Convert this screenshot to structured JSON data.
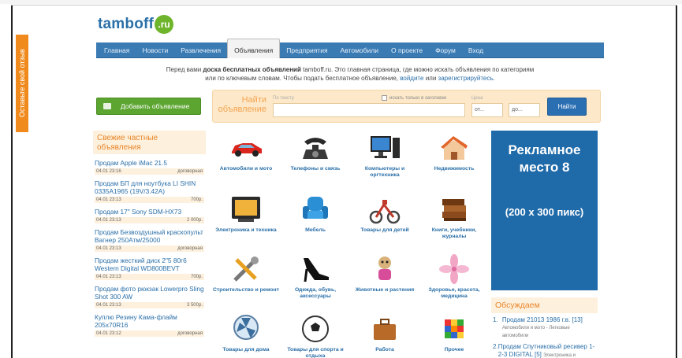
{
  "feedback_tab": "Оставьте свой отзыв",
  "logo": {
    "text": "tamboff",
    "badge": ".ru"
  },
  "nav": [
    "Главная",
    "Новости",
    "Развлечения",
    "Объявления",
    "Предприятия",
    "Автомобили",
    "О проекте",
    "Форум",
    "Вход"
  ],
  "intro": {
    "line1_prefix": "Перед вами ",
    "line1_bold": "доска бесплатных объявлений",
    "line1_suffix": " tamboff.ru. Это главная страница, где можно искать объявления по категориям",
    "line2_prefix": "или по ключевым словам. Чтобы подать бесплатное объявление, ",
    "link_login": "войдите",
    "line2_or": " или ",
    "link_register": "зарегистрируйтесь",
    "line2_end": "."
  },
  "add_button": "Добавить объявление",
  "search": {
    "title": "Найти объявление",
    "hint": "По тексту",
    "title_only": "искать только в заголовке",
    "price_label": "Цена",
    "price_from": "от...",
    "price_to": "до...",
    "find_button": "Найти"
  },
  "fresh": {
    "title": "Свежие частные объявления",
    "items": [
      {
        "title": "Продам Apple iMac 21.5",
        "date": "04.01 23:16",
        "price": "договорная"
      },
      {
        "title": "Продам БП для ноутбука LI SHIN 0335A1965 (19V/3.42A)",
        "date": "04.01 23:13",
        "price": "700р."
      },
      {
        "title": "Продам 17\" Sony SDM-HX73",
        "date": "04.01 23:13",
        "price": "2 000р."
      },
      {
        "title": "Продам Безвоздушный краскопульт Вагнер 250Атм/25000",
        "date": "04.01 23:13",
        "price": "договорная"
      },
      {
        "title": "Продам жесткий диск 2\"5 80г6 Western Digital WD800BEVT",
        "date": "04.01 23:13",
        "price": "700р."
      },
      {
        "title": "Продам фото рюкзак Lowerpro Sling Shot 300 AW",
        "date": "04.01 23:13",
        "price": "3 500р."
      },
      {
        "title": "Куплю Резину Кама-флайм 205х70R16",
        "date": "04.01 23:12",
        "price": "договорная"
      }
    ]
  },
  "categories": [
    {
      "label": "Автомобили и мото",
      "icon": "car-icon"
    },
    {
      "label": "Телефоны и связь",
      "icon": "phone-icon"
    },
    {
      "label": "Компьютеры и оргтехника",
      "icon": "computer-icon"
    },
    {
      "label": "Недвижимость",
      "icon": "house-icon"
    },
    {
      "label": "Электроника и техника",
      "icon": "tv-icon"
    },
    {
      "label": "Мебель",
      "icon": "armchair-icon"
    },
    {
      "label": "Товары для детей",
      "icon": "tricycle-icon"
    },
    {
      "label": "Книги, учебники, журналы",
      "icon": "books-icon"
    },
    {
      "label": "Строительство и ремонт",
      "icon": "tools-icon"
    },
    {
      "label": "Одежда, обувь, аксессуары",
      "icon": "shoe-icon"
    },
    {
      "label": "Животные и растения",
      "icon": "dog-icon"
    },
    {
      "label": "Здоровье, красота, медицина",
      "icon": "flower-icon"
    },
    {
      "label": "Товары для дома",
      "icon": "fan-icon"
    },
    {
      "label": "Товары для спорта и отдыха",
      "icon": "ball-icon"
    },
    {
      "label": "Работа",
      "icon": "briefcase-icon"
    },
    {
      "label": "Прочее",
      "icon": "cube-icon"
    }
  ],
  "banner": {
    "title": "Рекламное место 8",
    "size": "(200 х 300 пикс)"
  },
  "discuss": {
    "title": "Обсуждаем",
    "items": [
      {
        "num": "1.",
        "link": "Продам 21013 1986 г.в. [13]",
        "sub": "Автомобили и мото - Легковые автомобили"
      },
      {
        "num": "2.",
        "link": "Продам Спутниковый ресивер 1-2-3 DIGITAL [5]",
        "sub": "Электроника и"
      }
    ]
  },
  "colors": {
    "nav": "#3a7bb4",
    "accent_orange": "#f08a1c",
    "add_green": "#5da531",
    "banner_blue": "#1f6aa9",
    "link": "#2a6fa8"
  }
}
